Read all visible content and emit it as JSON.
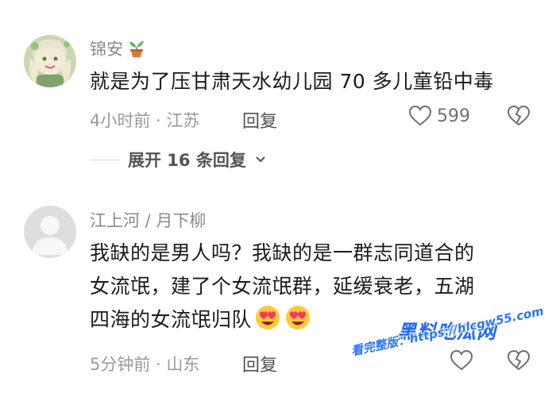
{
  "comments": [
    {
      "username": "锦安",
      "username_icon": "potted-plant-icon",
      "text": "就是为了压甘肃天水幼儿园 70 多儿童铅中毒",
      "meta": "4小时前 · 江苏",
      "reply_label": "回复",
      "like_count": "599",
      "expand_label": "展开 16 条回复"
    },
    {
      "username": "江上河 / 月下柳",
      "text_line1": "我缺的是男人吗？我缺的是一群志同道合的",
      "text_line2": "女流氓，建了个女流氓群，延缓衰老，五湖",
      "text_line3": "四海的女流氓归队",
      "emoji": "heart-eyes-emoji",
      "meta": "5分钟前 · 山东",
      "reply_label": "回复"
    }
  ],
  "watermark": {
    "title": "黑料吃瓜网",
    "url_prefix": "看完整版：",
    "url": "https://hlcgw55.com"
  },
  "colors": {
    "meta_gray": "#9a9a9a",
    "text": "#1b1b1b",
    "watermark_blue": "#1e66ff"
  }
}
